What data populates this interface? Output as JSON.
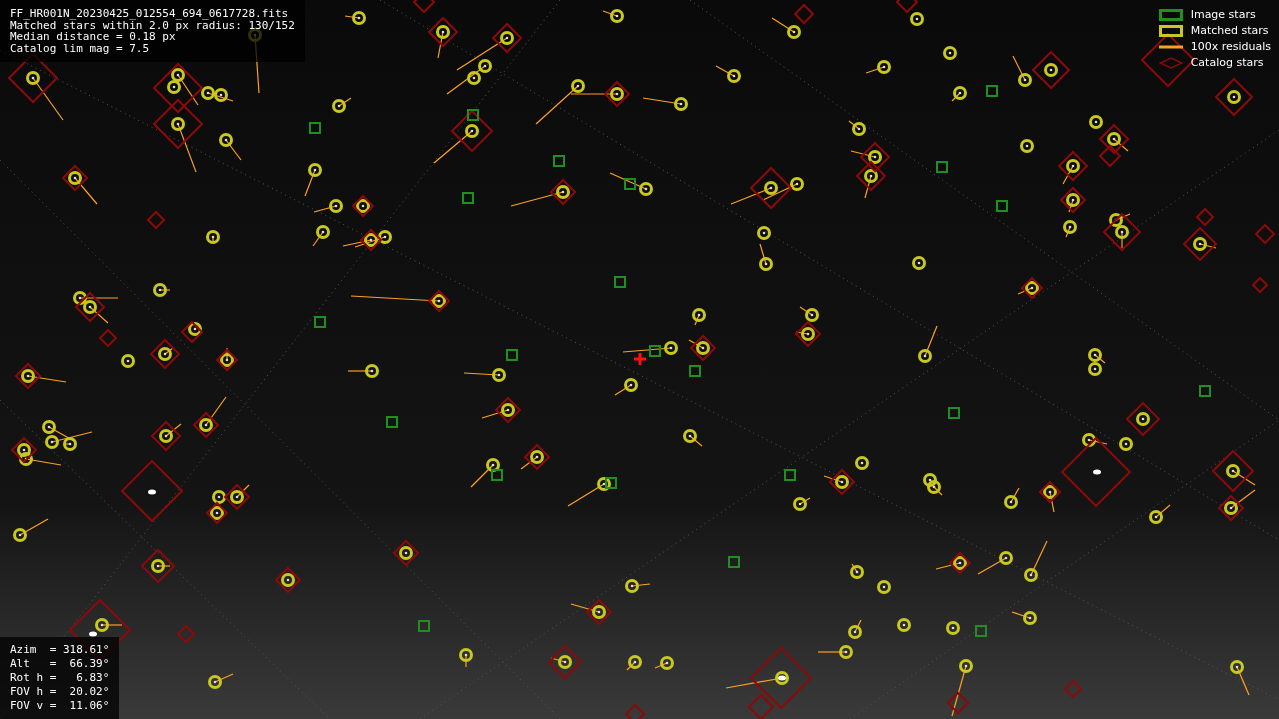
{
  "header": {
    "lines": [
      "FF_HR001N_20230425_012554_694_0617728.fits",
      "Matched stars within 2.0 px radius: 130/152",
      "Median distance = 0.18 px",
      "Catalog lim mag = 7.5"
    ]
  },
  "legend": [
    {
      "kind": "box",
      "color": "#1f8f1f",
      "label": "Image stars"
    },
    {
      "kind": "box",
      "color": "#c8c81e",
      "label": "Matched stars"
    },
    {
      "kind": "line",
      "color": "#ffa020",
      "label": "100x residuals"
    },
    {
      "kind": "diamond",
      "color": "#8b0a0a",
      "label": "Catalog stars"
    }
  ],
  "pointing": {
    "lines": [
      "Azim  = 318.61°",
      "Alt   =  66.39°",
      "Rot h =   6.83°",
      "FOV h =  20.02°",
      "FOV v =  11.06°"
    ]
  }
}
